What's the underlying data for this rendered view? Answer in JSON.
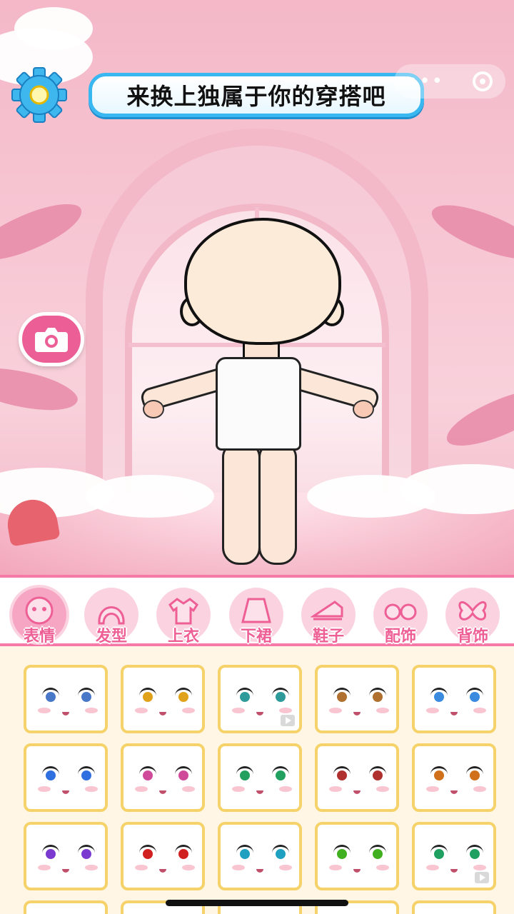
{
  "banner": {
    "text": "来换上独属于你的穿搭吧"
  },
  "icons": {
    "settings": "gear-icon",
    "camera": "camera-icon",
    "more": "more-dots-icon",
    "close": "target-close-icon"
  },
  "colors": {
    "accent_pink": "#ec5f96",
    "banner_border": "#39b7f0",
    "card_border": "#f6d36a",
    "tab_border": "#f57aa8"
  },
  "tabs": [
    {
      "label": "表情",
      "icon": "face-icon",
      "active": true
    },
    {
      "label": "发型",
      "icon": "hair-icon",
      "active": false
    },
    {
      "label": "上衣",
      "icon": "shirt-icon",
      "active": false
    },
    {
      "label": "下裙",
      "icon": "skirt-icon",
      "active": false
    },
    {
      "label": "鞋子",
      "icon": "shoe-icon",
      "active": false
    },
    {
      "label": "配饰",
      "icon": "glasses-icon",
      "active": false
    },
    {
      "label": "背饰",
      "icon": "wings-icon",
      "active": false
    }
  ],
  "expressions": [
    {
      "eye": "#4a78c8",
      "ad": false
    },
    {
      "eye": "#e0a21a",
      "ad": false
    },
    {
      "eye": "#2f9a9a",
      "ad": true
    },
    {
      "eye": "#b07030",
      "ad": false
    },
    {
      "eye": "#3a8ae0",
      "ad": false
    },
    {
      "eye": "#2f6fe0",
      "ad": false
    },
    {
      "eye": "#d04a9a",
      "ad": false
    },
    {
      "eye": "#22a060",
      "ad": false
    },
    {
      "eye": "#b03030",
      "ad": false
    },
    {
      "eye": "#d0701a",
      "ad": false
    },
    {
      "eye": "#7a3ad0",
      "ad": false
    },
    {
      "eye": "#d02020",
      "ad": false
    },
    {
      "eye": "#20a0c0",
      "ad": false
    },
    {
      "eye": "#40b020",
      "ad": false
    },
    {
      "eye": "#20a060",
      "ad": true
    }
  ]
}
